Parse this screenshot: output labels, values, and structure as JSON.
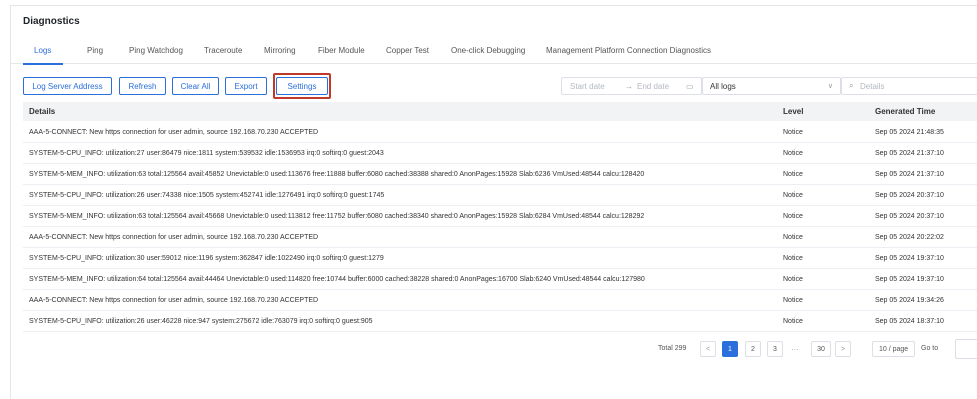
{
  "page": {
    "title": "Diagnostics"
  },
  "tabs": [
    {
      "label": "Logs",
      "active": true
    },
    {
      "label": "Ping"
    },
    {
      "label": "Ping Watchdog"
    },
    {
      "label": "Traceroute"
    },
    {
      "label": "Mirroring"
    },
    {
      "label": "Fiber Module"
    },
    {
      "label": "Copper Test"
    },
    {
      "label": "One-click Debugging"
    },
    {
      "label": "Management Platform Connection Diagnostics"
    }
  ],
  "toolbar": {
    "log_server_address": "Log Server Address",
    "refresh": "Refresh",
    "clear_all": "Clear All",
    "export": "Export",
    "settings": "Settings"
  },
  "filters": {
    "start_date_placeholder": "Start date",
    "end_date_placeholder": "End date",
    "log_type": "All logs",
    "search_placeholder": "Details"
  },
  "table": {
    "headers": {
      "details": "Details",
      "level": "Level",
      "time": "Generated Time"
    },
    "rows": [
      {
        "details": "AAA-5-CONNECT: New https connection for user admin, source 192.168.70.230 ACCEPTED",
        "level": "Notice",
        "time": "Sep 05 2024 21:48:35"
      },
      {
        "details": "SYSTEM-5-CPU_INFO: utilization:27 user:86479 nice:1811 system:539532 idle:1536953 irq:0 softirq:0 guest:2043",
        "level": "Notice",
        "time": "Sep 05 2024 21:37:10"
      },
      {
        "details": "SYSTEM-5-MEM_INFO: utilization:63 total:125564 avail:45852 Unevictable:0 used:113676 free:11888 buffer:6080 cached:38388 shared:0 AnonPages:15928 Slab:6236 VmUsed:48544 calcu:128420",
        "level": "Notice",
        "time": "Sep 05 2024 21:37:10"
      },
      {
        "details": "SYSTEM-5-CPU_INFO: utilization:26 user:74338 nice:1505 system:452741 idle:1276491 irq:0 softirq:0 guest:1745",
        "level": "Notice",
        "time": "Sep 05 2024 20:37:10"
      },
      {
        "details": "SYSTEM-5-MEM_INFO: utilization:63 total:125564 avail:45668 Unevictable:0 used:113812 free:11752 buffer:6080 cached:38340 shared:0 AnonPages:15928 Slab:6284 VmUsed:48544 calcu:128292",
        "level": "Notice",
        "time": "Sep 05 2024 20:37:10"
      },
      {
        "details": "AAA-5-CONNECT: New https connection for user admin, source 192.168.70.230 ACCEPTED",
        "level": "Notice",
        "time": "Sep 05 2024 20:22:02"
      },
      {
        "details": "SYSTEM-5-CPU_INFO: utilization:30 user:59012 nice:1196 system:362847 idle:1022490 irq:0 softirq:0 guest:1279",
        "level": "Notice",
        "time": "Sep 05 2024 19:37:10"
      },
      {
        "details": "SYSTEM-5-MEM_INFO: utilization:64 total:125564 avail:44464 Unevictable:0 used:114820 free:10744 buffer:6000 cached:38228 shared:0 AnonPages:16700 Slab:6240 VmUsed:48544 calcu:127980",
        "level": "Notice",
        "time": "Sep 05 2024 19:37:10"
      },
      {
        "details": "AAA-5-CONNECT: New https connection for user admin, source 192.168.70.230 ACCEPTED",
        "level": "Notice",
        "time": "Sep 05 2024 19:34:26"
      },
      {
        "details": "SYSTEM-5-CPU_INFO: utilization:26 user:46228 nice:947 system:275672 idle:763079 irq:0 softirq:0 guest:905",
        "level": "Notice",
        "time": "Sep 05 2024 18:37:10"
      }
    ]
  },
  "pagination": {
    "total": "Total 299",
    "prev": "<",
    "next": ">",
    "pages": [
      "1",
      "2",
      "3"
    ],
    "current": "1",
    "ellipsis": "···",
    "last": "30",
    "page_size": "10 / page",
    "goto": "Go to"
  },
  "colors": {
    "accent": "#2a6fdb",
    "highlight": "#c0392b"
  }
}
